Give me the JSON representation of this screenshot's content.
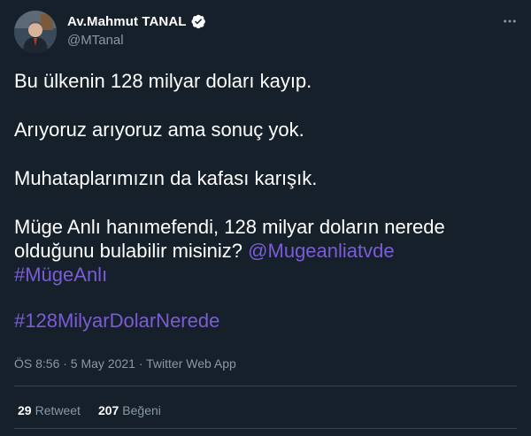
{
  "tweet": {
    "author": {
      "display_name": "Av.Mahmut TANAL",
      "handle": "@MTanal",
      "verified_icon": "verified-badge-icon"
    },
    "text": {
      "line1": "Bu ülkenin 128 milyar doları kayıp.",
      "line2": "Arıyoruz arıyoruz ama sonuç yok.",
      "line3": "Muhataplarımızın da kafası karışık.",
      "line4": "Müge Anlı hanımefendi, 128 milyar doların nerede",
      "line5_text": "olduğunu bulabilir misiniz?",
      "mention": "@Mugeanliatvde",
      "hashtag1": "#MügeAnlı",
      "hashtag2": "#128MilyarDolarNerede"
    },
    "meta": "ÖS 8:56 · 5 May 2021 · Twitter Web App",
    "stats": {
      "retweets_count": "29",
      "retweets_label": "Retweet",
      "likes_count": "207",
      "likes_label": "Beğeni"
    }
  },
  "colors": {
    "background": "#15202b",
    "link": "#7c5cd6",
    "muted": "#8899a6",
    "verified": "#ffffff"
  }
}
